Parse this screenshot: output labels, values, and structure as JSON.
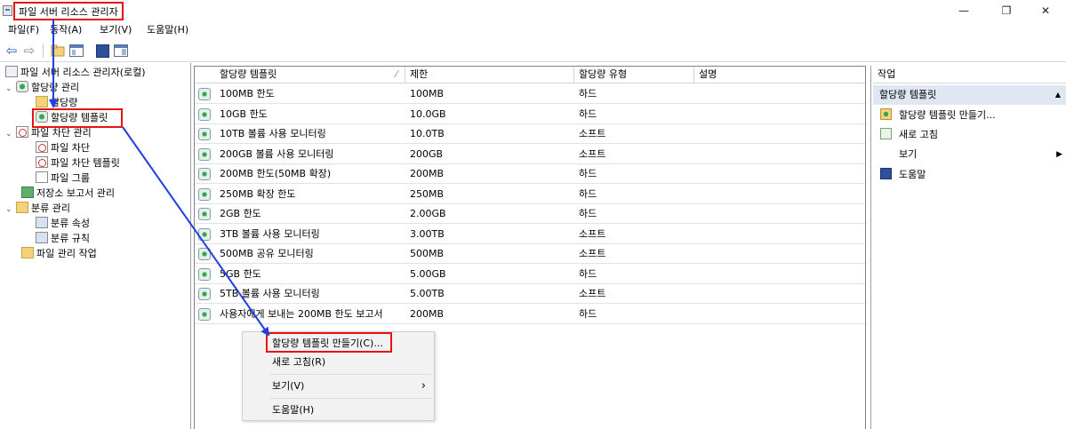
{
  "window": {
    "title": "파일 서버 리소스 관리자",
    "minimize_glyph": "—",
    "maximize_glyph": "❐",
    "close_glyph": "✕"
  },
  "menu": [
    "파일(F)",
    "동작(A)",
    "보기(V)",
    "도움말(H)"
  ],
  "toolbar": {
    "icons": [
      "back-arrow-icon",
      "forward-arrow-icon",
      "folder-up-icon",
      "console-tree-icon",
      "help-icon",
      "show-hide-pane-icon"
    ],
    "back_glyph": "⇦",
    "forward_glyph": "⇨",
    "help_glyph": "?"
  },
  "tree": {
    "root": "파일 서버 리소스 관리자(로컬)",
    "quota_mgmt": "할당량 관리",
    "quotas": "할당량",
    "quota_templates": "할당량 템플릿",
    "screening_mgmt": "파일 차단 관리",
    "file_screens": "파일 차단",
    "file_screen_templates": "파일 차단 템플릿",
    "file_groups": "파일 그룹",
    "storage_reports": "저장소 보고서 관리",
    "classification_mgmt": "분류 관리",
    "classification_props": "분류 속성",
    "classification_rules": "분류 규칙",
    "file_mgmt_tasks": "파일 관리 작업",
    "collapse_glyph": "⌄"
  },
  "list": {
    "columns": [
      "할당량 템플릿",
      "제한",
      "할당량 유형",
      "설명"
    ],
    "sort_glyph": "⁄",
    "rows": [
      {
        "name": "100MB 한도",
        "limit": "100MB",
        "type": "하드"
      },
      {
        "name": "10GB 한도",
        "limit": "10.0GB",
        "type": "하드"
      },
      {
        "name": "10TB 볼륨 사용 모니터링",
        "limit": "10.0TB",
        "type": "소프트"
      },
      {
        "name": "200GB 볼륨 사용 모니터링",
        "limit": "200GB",
        "type": "소프트"
      },
      {
        "name": "200MB 한도(50MB 확장)",
        "limit": "200MB",
        "type": "하드"
      },
      {
        "name": "250MB 확장 한도",
        "limit": "250MB",
        "type": "하드"
      },
      {
        "name": "2GB 한도",
        "limit": "2.00GB",
        "type": "하드"
      },
      {
        "name": "3TB 볼륨 사용 모니터링",
        "limit": "3.00TB",
        "type": "소프트"
      },
      {
        "name": "500MB 공유 모니터링",
        "limit": "500MB",
        "type": "소프트"
      },
      {
        "name": "5GB 한도",
        "limit": "5.00GB",
        "type": "하드"
      },
      {
        "name": "5TB 볼륨 사용 모니터링",
        "limit": "5.00TB",
        "type": "소프트"
      },
      {
        "name": "사용자에게 보내는 200MB 한도 보고서",
        "limit": "200MB",
        "type": "하드"
      }
    ]
  },
  "context_menu": {
    "create": "할당량 템플릿 만들기(C)...",
    "refresh": "새로 고침(R)",
    "view": "보기(V)",
    "view_arrow": "›",
    "help": "도움말(H)"
  },
  "actions": {
    "title": "작업",
    "section": "할당량 템플릿",
    "collapse_glyph": "▲",
    "create": "할당량 템플릿 만들기...",
    "refresh": "새로 고침",
    "view": "보기",
    "view_arrow": "▶",
    "help": "도움말"
  },
  "colors": {
    "highlight": "#e8120f",
    "arrow": "#1f3fe0",
    "section_bg": "#dfe8f2"
  }
}
